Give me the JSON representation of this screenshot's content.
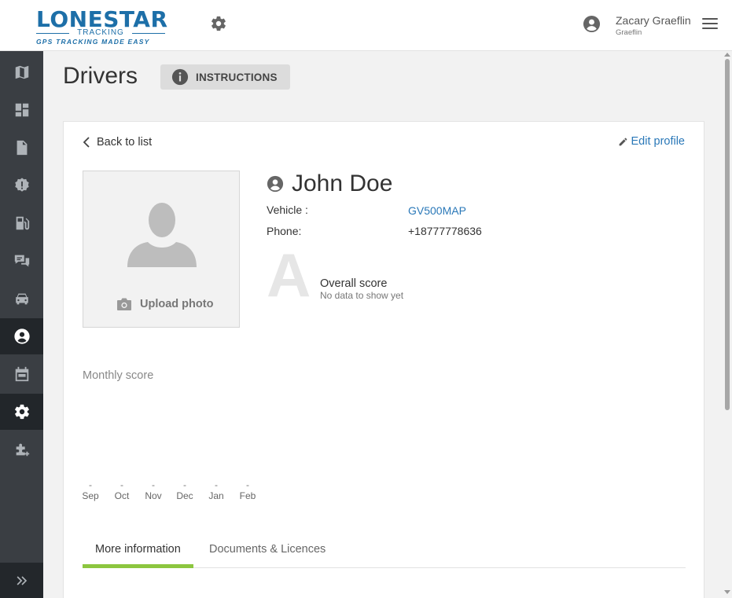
{
  "header": {
    "logo": {
      "main": "LONESTAR",
      "mid": "TRACKING",
      "sub": "GPS TRACKING MADE EASY"
    },
    "user_name": "Zacary Graeflin",
    "user_sub": "Graeflin"
  },
  "sidebar": {
    "items": [
      {
        "icon": "map-icon"
      },
      {
        "icon": "dashboard-icon"
      },
      {
        "icon": "reports-icon"
      },
      {
        "icon": "alerts-icon"
      },
      {
        "icon": "fuel-icon"
      },
      {
        "icon": "messages-icon"
      },
      {
        "icon": "vehicle-icon"
      },
      {
        "icon": "driver-icon",
        "active": true
      },
      {
        "icon": "calendar-icon"
      },
      {
        "icon": "settings-icon"
      },
      {
        "icon": "integrations-icon"
      }
    ],
    "expand_icon": "double-chevron-right-icon"
  },
  "page": {
    "title": "Drivers",
    "instructions_label": "INSTRUCTIONS"
  },
  "profile": {
    "back_label": "Back to list",
    "edit_label": "Edit profile",
    "upload_label": "Upload photo",
    "name": "John Doe",
    "vehicle_label": "Vehicle :",
    "vehicle_value": "GV500MAP",
    "phone_label": "Phone:",
    "phone_value": "+18777778636",
    "grade": "A",
    "overall_label": "Overall score",
    "overall_sub": "No data to show yet"
  },
  "monthly": {
    "title": "Monthly score",
    "months": [
      {
        "label": "Sep",
        "value": "-"
      },
      {
        "label": "Oct",
        "value": "-"
      },
      {
        "label": "Nov",
        "value": "-"
      },
      {
        "label": "Dec",
        "value": "-"
      },
      {
        "label": "Jan",
        "value": "-"
      },
      {
        "label": "Feb",
        "value": "-"
      }
    ]
  },
  "tabs": [
    {
      "label": "More information",
      "active": true
    },
    {
      "label": "Documents & Licences",
      "active": false
    }
  ],
  "colors": {
    "accent": "#8cc63f",
    "link": "#2a78b8",
    "brand": "#1d6fa8",
    "sidebar": "#3a3e43"
  }
}
